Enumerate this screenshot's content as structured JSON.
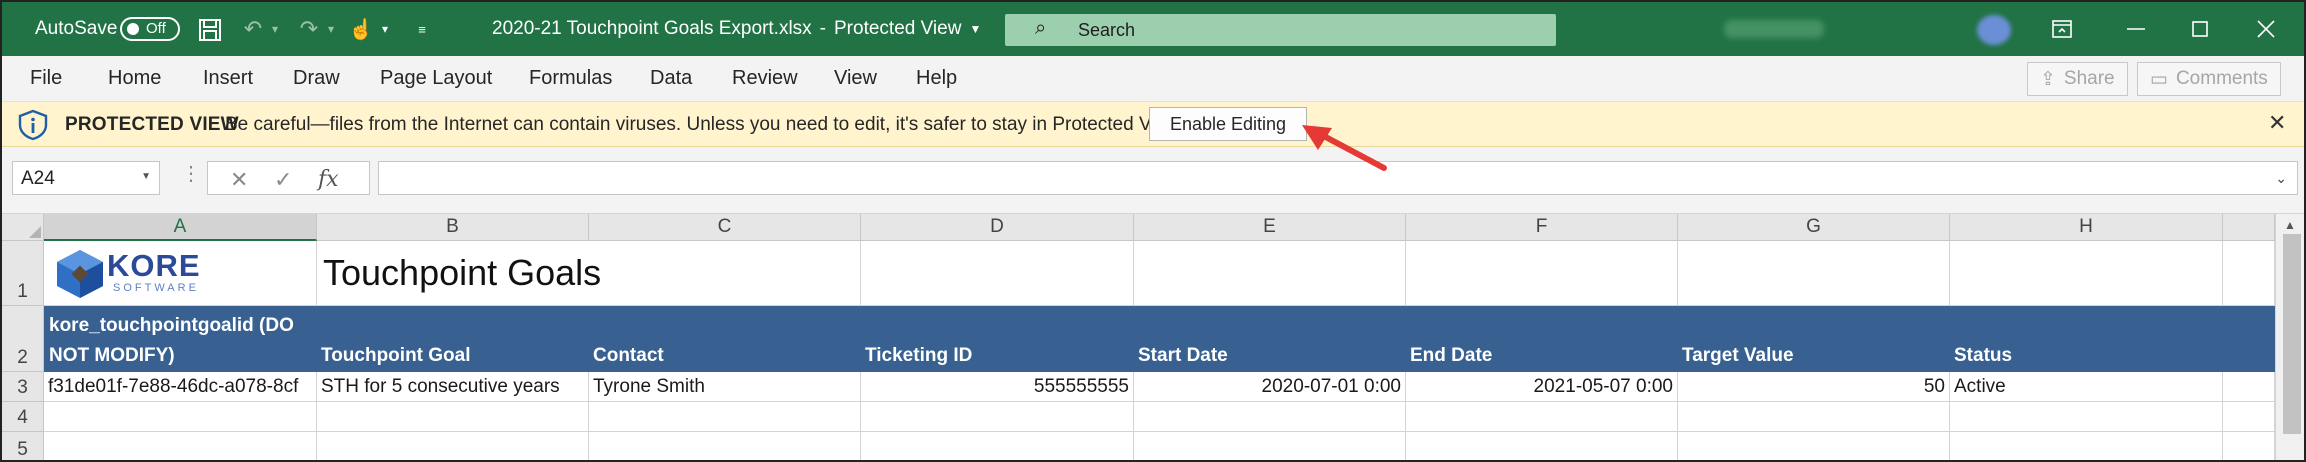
{
  "titlebar": {
    "autosave_label": "AutoSave",
    "autosave_state": "Off",
    "filename": "2020-21 Touchpoint Goals Export.xlsx",
    "separator": "-",
    "mode": "Protected View",
    "search_placeholder": "Search"
  },
  "menu": {
    "items": [
      "File",
      "Home",
      "Insert",
      "Draw",
      "Page Layout",
      "Formulas",
      "Data",
      "Review",
      "View",
      "Help"
    ],
    "share_label": "Share",
    "comments_label": "Comments"
  },
  "protected_view": {
    "title": "PROTECTED VIEW",
    "message": "Be careful—files from the Internet can contain viruses. Unless you need to edit, it's safer to stay in Protected View.",
    "button_label": "Enable Editing"
  },
  "formula_bar": {
    "name_box": "A24",
    "formula": ""
  },
  "sheet": {
    "columns": [
      "A",
      "B",
      "C",
      "D",
      "E",
      "F",
      "G",
      "H"
    ],
    "selected_column": "A",
    "rows": [
      "1",
      "2",
      "3",
      "4",
      "5"
    ],
    "logo_text": "KORE",
    "logo_subtext": "SOFTWARE",
    "title": "Touchpoint Goals",
    "headers": {
      "goalid_line1": "kore_touchpointgoalid (DO",
      "goalid_line2": "NOT MODIFY)",
      "goal": "Touchpoint Goal",
      "contact": "Contact",
      "ticketing_id": "Ticketing ID",
      "start_date": "Start Date",
      "end_date": "End Date",
      "target_value": "Target Value",
      "status": "Status"
    },
    "row3": {
      "goalid": "f31de01f-7e88-46dc-a078-8cf",
      "goal": "STH for 5 consecutive years",
      "contact": "Tyrone Smith",
      "ticketing_id": "555555555",
      "start_date": "2020-07-01 0:00",
      "end_date": "2021-05-07 0:00",
      "target_value": "50",
      "status": "Active"
    }
  },
  "colors": {
    "excel_green": "#217346",
    "header_band": "#386192",
    "protected_bar": "#fff4ce",
    "annotation_arrow": "#e53935"
  }
}
